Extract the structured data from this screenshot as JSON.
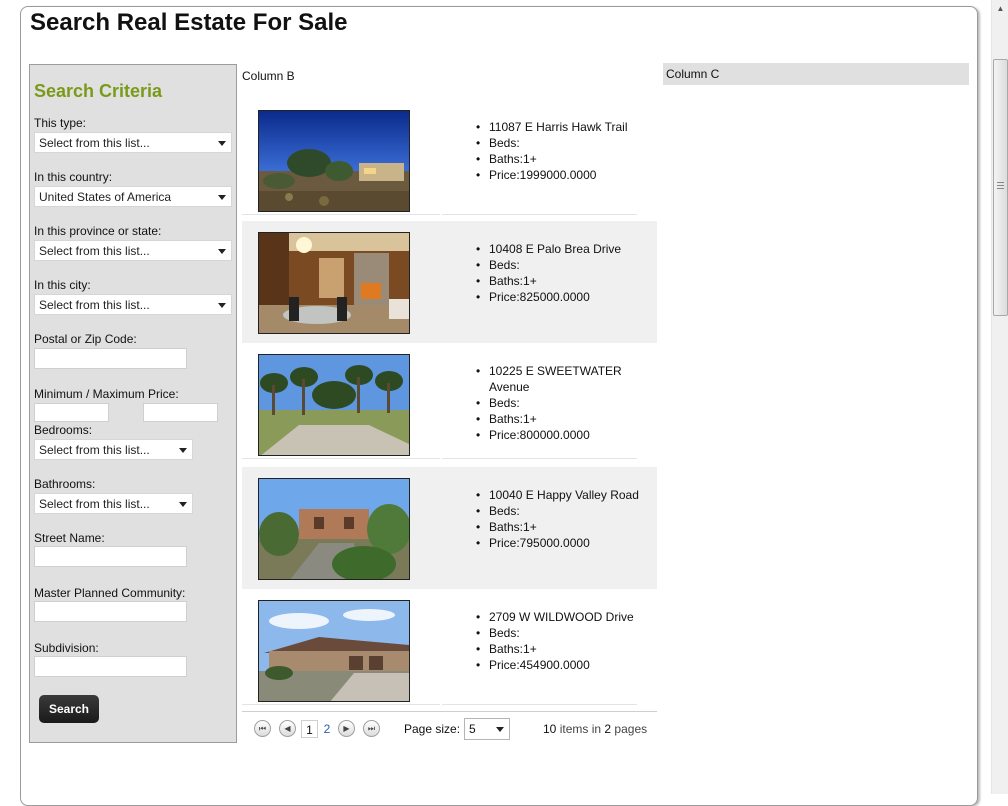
{
  "page": {
    "title": "Search Real Estate For Sale"
  },
  "search": {
    "heading": "Search Criteria",
    "type_label": "This type:",
    "type_value": "Select from this list...",
    "country_label": "In this country:",
    "country_value": "United States of America",
    "state_label": "In this province or state:",
    "state_value": "Select from this list...",
    "city_label": "In this city:",
    "city_value": "Select from this list...",
    "postal_label": "Postal or Zip Code:",
    "price_label": "Minimum / Maximum Price:",
    "bedrooms_label": "Bedrooms:",
    "bedrooms_value": "Select from this list...",
    "bathrooms_label": "Bathrooms:",
    "bathrooms_value": "Select from this list...",
    "street_label": "Street Name:",
    "community_label": "Master Planned Community:",
    "subdivision_label": "Subdivision:",
    "button_label": "Search"
  },
  "column_b": {
    "label": "Column B",
    "listings": [
      {
        "address": "11087 E Harris Hawk Trail",
        "beds": "Beds:",
        "baths": "Baths:1+",
        "price": "Price:1999000.0000"
      },
      {
        "address": "10408 E Palo Brea Drive",
        "beds": "Beds:",
        "baths": "Baths:1+",
        "price": "Price:825000.0000"
      },
      {
        "address": "10225 E SWEETWATER Avenue",
        "beds": "Beds:",
        "baths": "Baths:1+",
        "price": "Price:800000.0000"
      },
      {
        "address": "10040 E Happy Valley Road",
        "beds": "Beds:",
        "baths": "Baths:1+",
        "price": "Price:795000.0000"
      },
      {
        "address": "2709 W WILDWOOD Drive",
        "beds": "Beds:",
        "baths": "Baths:1+",
        "price": "Price:454900.0000"
      }
    ]
  },
  "pager": {
    "first_icon": "first-page-icon",
    "prev_icon": "prev-page-icon",
    "next_icon": "next-page-icon",
    "last_icon": "last-page-icon",
    "page_1": "1",
    "page_2": "2",
    "page_size_label": "Page size:",
    "page_size_value": "5",
    "info_count": "10",
    "info_mid": "items in",
    "info_pages": "2",
    "info_end": "pages"
  },
  "column_c": {
    "label": "Column C"
  }
}
